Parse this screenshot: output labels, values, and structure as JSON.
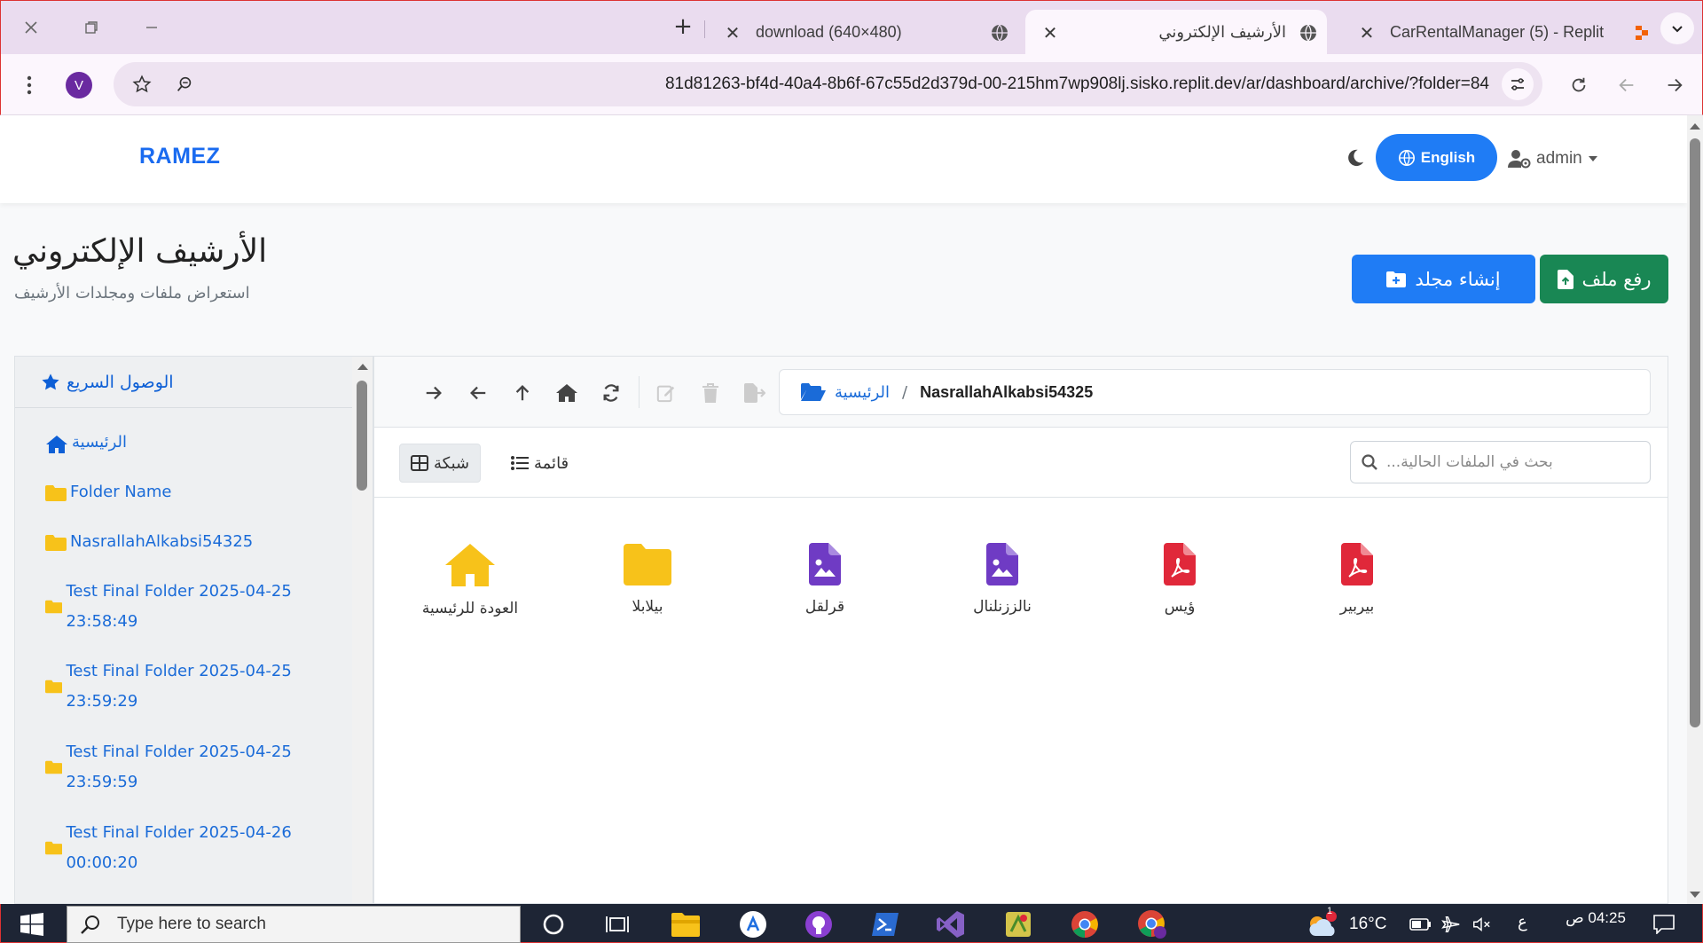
{
  "browser": {
    "tabs": [
      {
        "title": "download (640×480)",
        "active": false
      },
      {
        "title": "الأرشيف الإلكتروني",
        "active": true
      },
      {
        "title": "CarRentalManager (5) - Replit",
        "active": false
      }
    ],
    "url": "81d81263-bf4d-40a4-8b6f-67c55d2d379d-00-215hm7wp908lj.sisko.replit.dev/ar/dashboard/archive/?folder=84",
    "profile_initial": "V"
  },
  "app": {
    "brand": "RAMEZ",
    "language_button": "English",
    "user_menu": "admin"
  },
  "page": {
    "title": "الأرشيف الإلكتروني",
    "subtitle": "استعراض ملفات ومجلدات الأرشيف",
    "upload_button": "رفع ملف",
    "create_folder_button": "إنشاء مجلد"
  },
  "sidebar": {
    "heading": "الوصول السريع",
    "items": [
      {
        "label": "الرئيسية",
        "icon": "home-icon"
      },
      {
        "label": "Folder Name",
        "icon": "folder-icon"
      },
      {
        "label": "NasrallahAlkabsi54325",
        "icon": "folder-icon"
      },
      {
        "label": "Test Final Folder 2025-04-25 23:58:49",
        "icon": "folder-icon"
      },
      {
        "label": "Test Final Folder 2025-04-25 23:59:29",
        "icon": "folder-icon"
      },
      {
        "label": "Test Final Folder 2025-04-25 23:59:59",
        "icon": "folder-icon"
      },
      {
        "label": "Test Final Folder 2025-04-26 00:00:20",
        "icon": "folder-icon"
      }
    ]
  },
  "breadcrumb": {
    "root": "الرئيسية",
    "separator": "/",
    "current": "NasrallahAlkabsi54325"
  },
  "view": {
    "grid_label": "شبكة",
    "list_label": "قائمة",
    "search_placeholder": "بحث في الملفات الحالية..."
  },
  "files": [
    {
      "name": "العودة للرئيسية",
      "type": "home",
      "color": "#f7c21a"
    },
    {
      "name": "بيلابلا",
      "type": "folder",
      "color": "#f7c21a"
    },
    {
      "name": "قرلقل",
      "type": "image",
      "color": "#6f3bc4"
    },
    {
      "name": "نالززنلنال",
      "type": "image",
      "color": "#6f3bc4"
    },
    {
      "name": "ؤيس",
      "type": "pdf",
      "color": "#e0283a"
    },
    {
      "name": "بيربير",
      "type": "pdf",
      "color": "#e0283a"
    }
  ],
  "taskbar": {
    "search_placeholder": "Type here to search",
    "weather": "16°C",
    "time": "04:25 ص",
    "lang_indicator": "ع",
    "notification_count": "1"
  },
  "colors": {
    "primary": "#1f7cf5",
    "success": "#198754",
    "folder": "#f7c21a",
    "pdf": "#e0283a",
    "image": "#6f3bc4"
  }
}
